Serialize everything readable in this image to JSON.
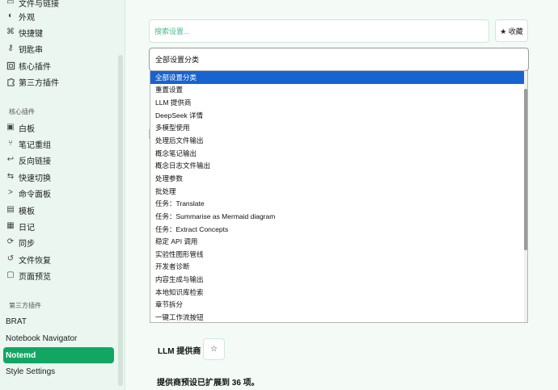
{
  "sidebar": {
    "top_items": [
      {
        "label": "文件与链接",
        "icon": "folder-icon"
      },
      {
        "label": "外观",
        "icon": "palette-icon"
      },
      {
        "label": "快捷键",
        "icon": "command-icon"
      },
      {
        "label": "钥匙串",
        "icon": "key-icon"
      },
      {
        "label": "核心插件",
        "icon": "plugin-icon"
      },
      {
        "label": "第三方插件",
        "icon": "puzzle-icon"
      }
    ],
    "core_section_label": "核心插件",
    "core_items": [
      {
        "label": "白板",
        "icon": "canvas-icon"
      },
      {
        "label": "笔记重组",
        "icon": "merge-icon"
      },
      {
        "label": "反向链接",
        "icon": "backlink-icon"
      },
      {
        "label": "快速切换",
        "icon": "switch-icon"
      },
      {
        "label": "命令面板",
        "icon": "terminal-icon"
      },
      {
        "label": "模板",
        "icon": "template-icon"
      },
      {
        "label": "日记",
        "icon": "calendar-icon"
      },
      {
        "label": "同步",
        "icon": "sync-icon"
      },
      {
        "label": "文件恢复",
        "icon": "history-icon"
      },
      {
        "label": "页面预览",
        "icon": "preview-icon"
      }
    ],
    "third_party_section_label": "第三方插件",
    "plugins": [
      {
        "label": "BRAT",
        "active": false
      },
      {
        "label": "Notebook Navigator",
        "active": false
      },
      {
        "label": "Notemd",
        "active": true
      },
      {
        "label": "Style Settings",
        "active": false
      }
    ]
  },
  "main": {
    "search_placeholder": "搜索设置...",
    "favorites_label": "★ 收藏",
    "category_select_value": "全部设置分类",
    "dropdown_options": [
      "全部设置分类",
      "重置设置",
      "LLM 提供商",
      "DeepSeek 详情",
      "多模型使用",
      "处理后文件输出",
      "概念笔记输出",
      "概念日志文件输出",
      "处理参数",
      "批处理",
      "任务：Translate",
      "任务：Summarise as Mermaid diagram",
      "任务：Extract Concepts",
      "稳定 API 调用",
      "实验性图形管线",
      "开发者诊断",
      "内容生成与输出",
      "本地知识库检索",
      "章节拆分",
      "一键工作流按钮"
    ],
    "selected_option_index": 0,
    "llm_heading": "LLM 提供商",
    "star_button": "☆",
    "provider_note": "提供商预设已扩展到 36 项。"
  },
  "colors": {
    "accent": "#11a763",
    "selection": "#1763d0",
    "background": "#f4fbf7",
    "sidebar": "#eaf6ef"
  }
}
